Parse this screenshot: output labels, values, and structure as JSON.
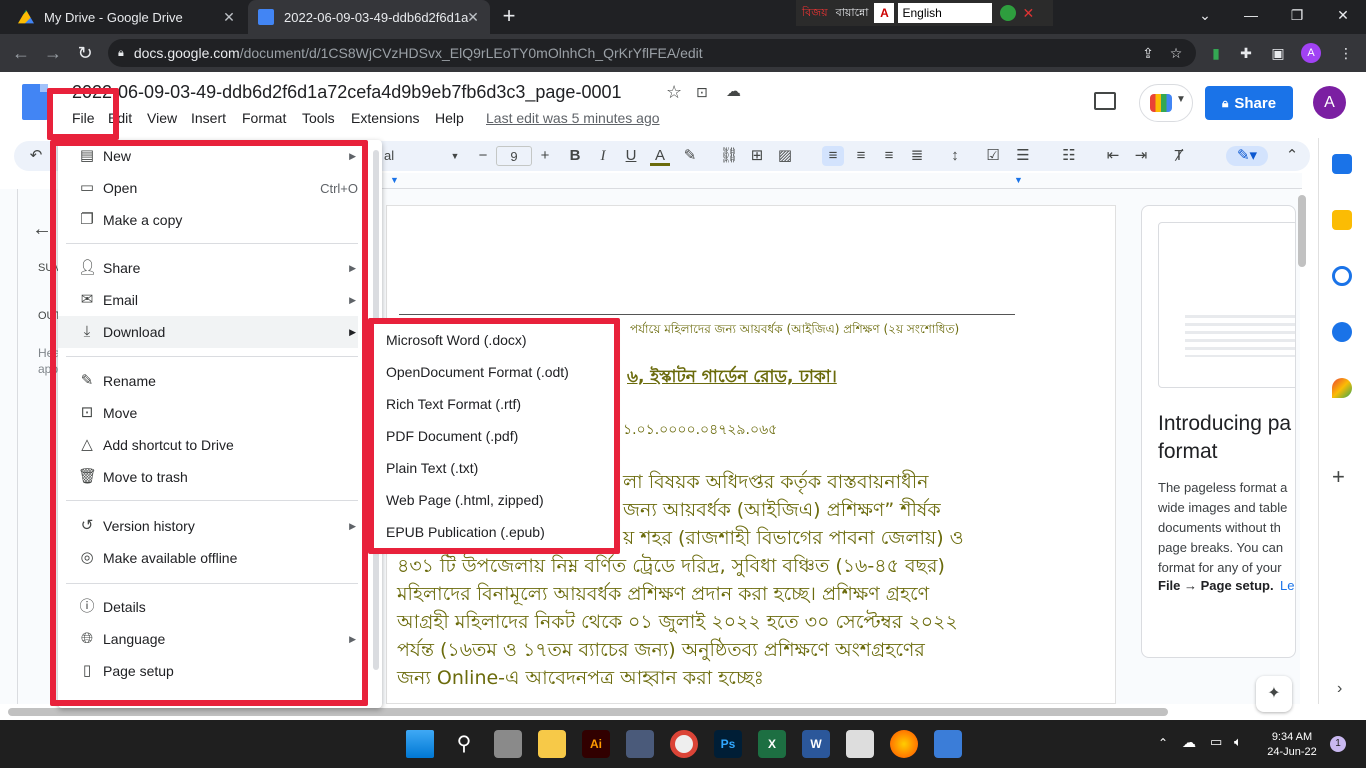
{
  "browser": {
    "tabs": [
      {
        "title": "My Drive - Google Drive",
        "active": false
      },
      {
        "title": "2022-06-09-03-49-ddb6d2f6d1a",
        "active": true
      }
    ],
    "url_host": "docs.google.com",
    "url_path": "/document/d/1CS8WjCVzHDSvx_ElQ9rLEoTY0mOlnhCh_QrKrYflFEA/edit",
    "language_bar": {
      "bangla_label": "বিজয়",
      "bangla_label2": "বায়ান্নো",
      "language": "English"
    },
    "profile_initial": "A"
  },
  "docs": {
    "title": "2022-06-09-03-49-ddb6d2f6d1a72cefa4d9b9eb7fb6d3c3_page-0001",
    "menu": [
      "File",
      "Edit",
      "View",
      "Insert",
      "Format",
      "Tools",
      "Extensions",
      "Help"
    ],
    "last_edit": "Last edit was 5 minutes ago",
    "share_label": "Share",
    "avatar_initial": "A",
    "toolbar": {
      "font": "al",
      "font_size": "9"
    }
  },
  "outline": {
    "summary": "SUM",
    "outline": "OUTL",
    "hint_line1": "Hea",
    "hint_line2": "appe"
  },
  "file_menu": {
    "items": [
      {
        "icon": "new-doc-icon",
        "label": "New",
        "submenu": true
      },
      {
        "icon": "folder-open-icon",
        "label": "Open",
        "shortcut": "Ctrl+O"
      },
      {
        "icon": "copy-icon",
        "label": "Make a copy"
      },
      {
        "icon": "share-person-icon",
        "label": "Share",
        "submenu": true
      },
      {
        "icon": "email-icon",
        "label": "Email",
        "submenu": true
      },
      {
        "icon": "download-icon",
        "label": "Download",
        "submenu": true
      },
      {
        "icon": "rename-icon",
        "label": "Rename"
      },
      {
        "icon": "move-folder-icon",
        "label": "Move"
      },
      {
        "icon": "add-shortcut-icon",
        "label": "Add shortcut to Drive"
      },
      {
        "icon": "trash-icon",
        "label": "Move to trash"
      },
      {
        "icon": "history-icon",
        "label": "Version history",
        "submenu": true
      },
      {
        "icon": "offline-icon",
        "label": "Make available offline"
      },
      {
        "icon": "info-icon",
        "label": "Details"
      },
      {
        "icon": "globe-icon",
        "label": "Language",
        "submenu": true
      },
      {
        "icon": "page-setup-icon",
        "label": "Page setup"
      }
    ]
  },
  "download_submenu": {
    "items": [
      "Microsoft Word (.docx)",
      "OpenDocument Format (.odt)",
      "Rich Text Format (.rtf)",
      "PDF Document (.pdf)",
      "Plain Text (.txt)",
      "Web Page (.html, zipped)",
      "EPUB Publication (.epub)"
    ]
  },
  "document_content": {
    "header_line": "পর্যায়ে মহিলাদের জন্য আয়বর্ধক (আইজিএ) প্রশিক্ষণ (২য় সংশোধিত)",
    "address": "৬, ইস্কাটন গার্ডেন রোড, ঢাকা।",
    "memo": "১.০১.০০০০.০৪৭২৯.০৬৫",
    "para": [
      "লা বিষয়ক অধিদপ্তর কর্তৃক বাস্তবায়নাধীন",
      "জন্য আয়বর্ধক (আইজিএ) প্রশিক্ষণ” শীর্ষক",
      "য় শহর (রাজশাহী বিভাগের পাবনা জেলায়) ও",
      "৪৩১ টি উপজেলায় নিম্ন বর্ণিত ট্রেডে দরিদ্র, সুবিধা বঞ্চিত (১৬-৪৫ বছর)",
      "মহিলাদের বিনামূল্যে আয়বর্ধক প্রশিক্ষণ প্রদান করা হচ্ছে। প্রশিক্ষণ গ্রহণে",
      "আগ্রহী মহিলাদের নিকট থেকে ০১ জুলাই ২০২২ হতে ৩০ সেপ্টেম্বর ২০২২",
      "পর্যন্ত (১৬তম ও ১৭তম ব্যাচের জন্য) অনুষ্ঠিতব্য প্রশিক্ষণে অংশগ্রহণের",
      "জন্য Online-এ আবেদনপত্র আহ্বান করা হচ্ছেঃ"
    ]
  },
  "side_card": {
    "heading": "Introducing pa format",
    "body": "The pageless format a wide images and table documents without th page breaks. You can format for any of your",
    "path": "File → Page setup.",
    "link": "Le"
  },
  "taskbar": {
    "time": "9:34 AM",
    "date": "24-Jun-22",
    "notification_count": "1"
  },
  "colors": {
    "accent": "#1a73e8",
    "highlight_red": "#e8213b",
    "doc_text": "#6b6b0c"
  }
}
